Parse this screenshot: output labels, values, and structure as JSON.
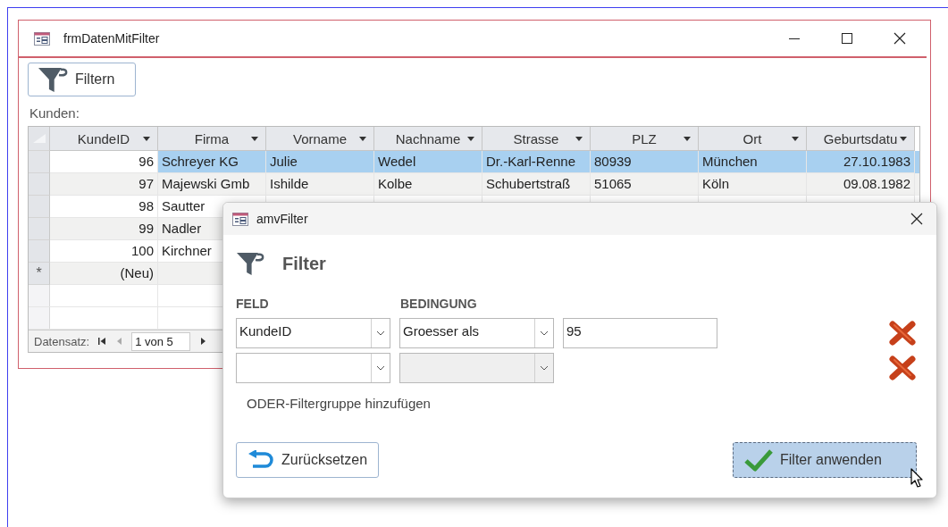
{
  "form": {
    "title": "frmDatenMitFilter",
    "filter_button": "Filtern",
    "list_label": "Kunden:",
    "table": {
      "columns": [
        {
          "label": "KundeID",
          "kind": "number"
        },
        {
          "label": "Firma",
          "kind": "text"
        },
        {
          "label": "Vorname",
          "kind": "text"
        },
        {
          "label": "Nachname",
          "kind": "text"
        },
        {
          "label": "Strasse",
          "kind": "text"
        },
        {
          "label": "PLZ",
          "kind": "text"
        },
        {
          "label": "Ort",
          "kind": "text"
        },
        {
          "label": "Geburtsdatu",
          "kind": "date"
        }
      ],
      "rows": [
        {
          "selected": true,
          "cells": [
            "96",
            "Schreyer KG",
            "Julie",
            "Wedel",
            "Dr.-Karl-Renne",
            "80939",
            "München",
            "27.10.1983"
          ]
        },
        {
          "selected": false,
          "cells": [
            "97",
            "Majewski Gmb",
            "Ishilde",
            "Kolbe",
            "Schubertstraß",
            "51065",
            "Köln",
            "09.08.1982"
          ]
        },
        {
          "selected": false,
          "cells": [
            "98",
            "Sautter"
          ]
        },
        {
          "selected": false,
          "cells": [
            "99",
            "Nadler"
          ]
        },
        {
          "selected": false,
          "cells": [
            "100",
            "Kirchner"
          ]
        },
        {
          "selected": false,
          "marker": "*",
          "cells": [
            "(Neu)"
          ]
        }
      ]
    },
    "navigation": {
      "label": "Datensatz:",
      "position": "1 von 5"
    }
  },
  "dialog": {
    "title": "amvFilter",
    "heading": "Filter",
    "field_label": "FELD",
    "condition_label": "BEDINGUNG",
    "conditions": [
      {
        "field": "KundeID",
        "condition": "Groesser als",
        "value": "95",
        "condition_disabled": false
      },
      {
        "condition_disabled": true
      }
    ],
    "add_group": "ODER-Filtergruppe hinzufügen",
    "reset_button": "Zurücksetzen",
    "apply_button": {
      "label": "Filter anwenden",
      "focused": true
    }
  }
}
